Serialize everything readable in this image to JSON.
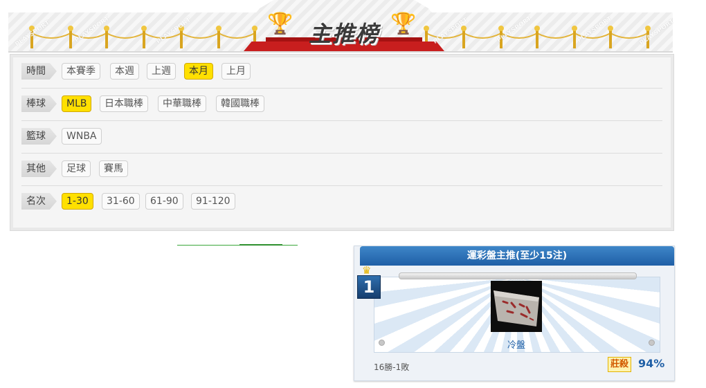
{
  "header": {
    "title": "主推榜",
    "watermark": "PLAYSPORT"
  },
  "filters": [
    {
      "label": "時間",
      "options": [
        {
          "text": "本賽季",
          "active": false
        },
        {
          "text": "本週",
          "active": false
        },
        {
          "text": "上週",
          "active": false
        },
        {
          "text": "本月",
          "active": true
        },
        {
          "text": "上月",
          "active": false
        }
      ]
    },
    {
      "label": "棒球",
      "options": [
        {
          "text": "MLB",
          "active": true
        },
        {
          "text": "日本職棒",
          "active": false
        },
        {
          "text": "中華職棒",
          "active": false
        },
        {
          "text": "韓國職棒",
          "active": false
        }
      ]
    },
    {
      "label": "籃球",
      "options": [
        {
          "text": "WNBA",
          "active": false
        }
      ]
    },
    {
      "label": "其他",
      "options": [
        {
          "text": "足球",
          "active": false
        },
        {
          "text": "賽馬",
          "active": false
        }
      ]
    },
    {
      "label": "名次",
      "options": [
        {
          "text": "1-30",
          "active": true
        },
        {
          "text": "31-60",
          "active": false
        },
        {
          "text": "61-90",
          "active": false
        },
        {
          "text": "91-120",
          "active": false
        }
      ]
    }
  ],
  "ranking": {
    "heading": "運彩盤主推(至少15注)",
    "top": {
      "rank": "1",
      "name": "冷盤",
      "record": "16勝-1敗",
      "play_type": "莊殺",
      "win_rate": "94%"
    }
  },
  "colors": {
    "active": "#ffe000",
    "accent": "#1f5fa6",
    "stage": "#c81e1e"
  },
  "icons": {
    "trophy": "trophy-icon",
    "crown": "crown-icon"
  }
}
